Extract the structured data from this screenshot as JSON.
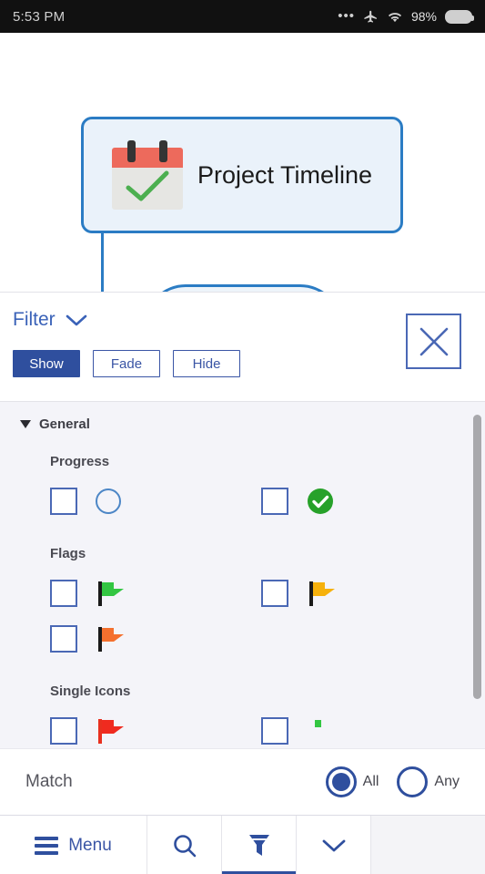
{
  "statusbar": {
    "time": "5:53 PM",
    "dots": "•••",
    "airplane_icon": "airplane-icon",
    "wifi_icon": "wifi-icon",
    "battery_percent": "98%",
    "battery_icon": "battery-icon"
  },
  "canvas": {
    "main_node": {
      "title": "Project Timeline",
      "icon": "calendar-check-icon",
      "border_color": "#2b7cc4",
      "fill_color": "#eaf2fa"
    },
    "child_node": {
      "fill_color": "#eef4fa",
      "bar_color": "#61a8dd"
    }
  },
  "filter_panel": {
    "title": "Filter",
    "chevron_icon": "chevron-down-icon",
    "close_icon": "close-icon",
    "modes": [
      {
        "label": "Show",
        "selected": true
      },
      {
        "label": "Fade",
        "selected": false
      },
      {
        "label": "Hide",
        "selected": false
      }
    ],
    "accent_color": "#2f4f9e",
    "groups": [
      {
        "label": "General",
        "expanded": true,
        "sections": [
          {
            "label": "Progress",
            "rows": [
              [
                {
                  "icon": "progress-empty-circle-icon",
                  "checked": false
                },
                {
                  "icon": "progress-complete-check-icon",
                  "checked": false
                }
              ]
            ]
          },
          {
            "label": "Flags",
            "rows": [
              [
                {
                  "icon": "flag-green-icon",
                  "checked": false
                },
                {
                  "icon": "flag-yellow-icon",
                  "checked": false
                }
              ],
              [
                {
                  "icon": "flag-orange-icon",
                  "checked": false
                },
                {
                  "icon": "",
                  "checked": null
                }
              ]
            ]
          },
          {
            "label": "Single Icons",
            "rows": [
              [
                {
                  "icon": "flag-red-icon",
                  "checked": false
                },
                {
                  "icon": "flag-green-small-icon",
                  "checked": false
                }
              ]
            ]
          }
        ]
      }
    ]
  },
  "match_bar": {
    "label": "Match",
    "options": [
      {
        "label": "All",
        "selected": true
      },
      {
        "label": "Any",
        "selected": false
      }
    ]
  },
  "toolbar": {
    "menu_label": "Menu",
    "menu_icon": "hamburger-icon",
    "search_icon": "search-icon",
    "filter_icon": "funnel-icon",
    "expand_icon": "chevron-down-icon",
    "active_item": "filter"
  }
}
